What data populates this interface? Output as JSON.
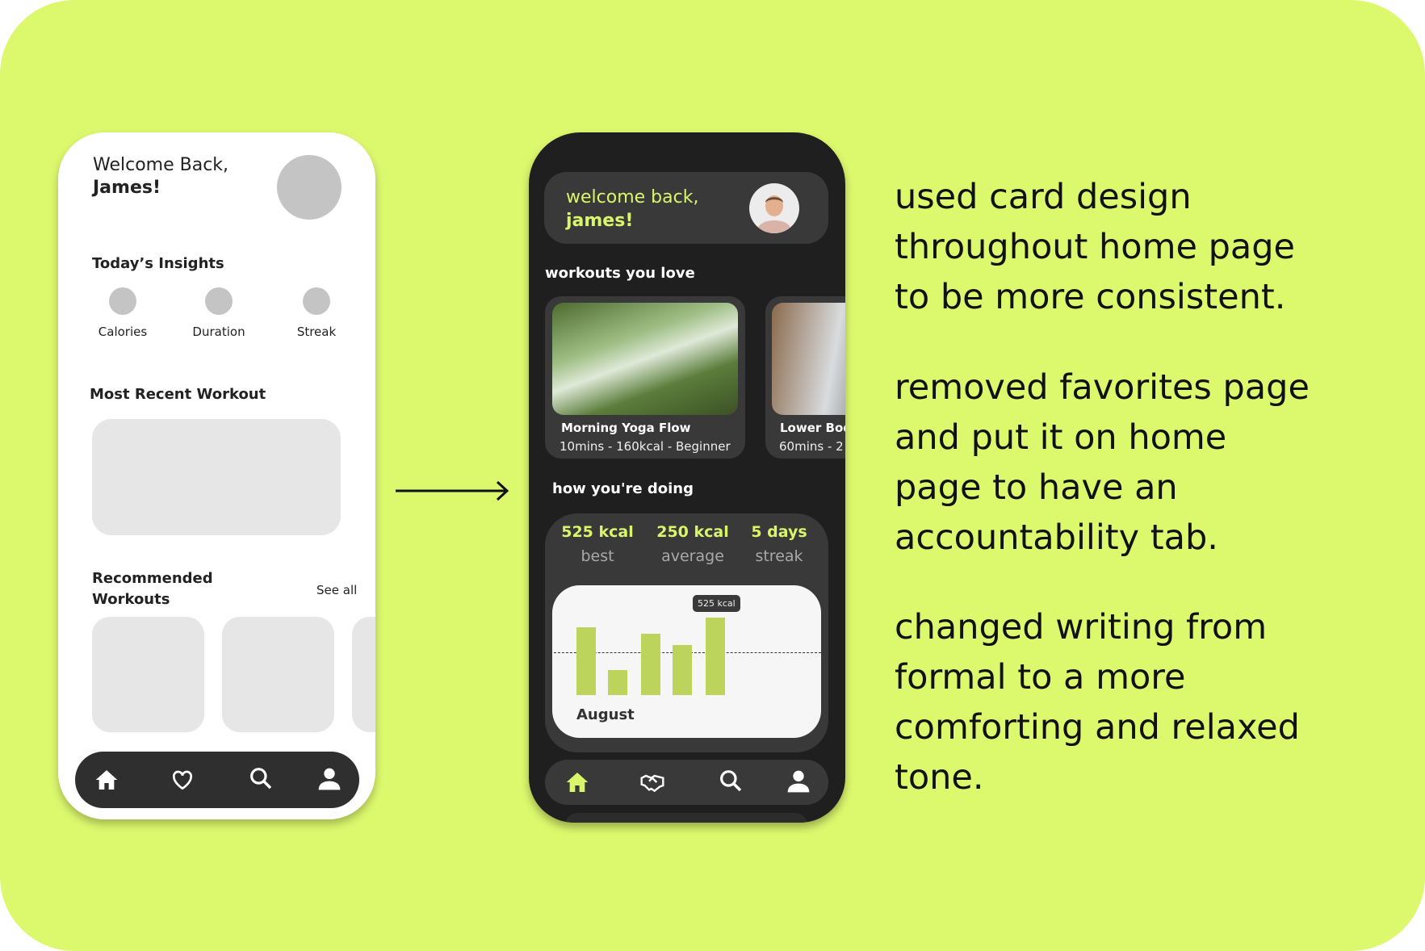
{
  "before": {
    "greeting": "Welcome Back,",
    "name": "James!",
    "insights_title": "Today’s Insights",
    "insights": [
      {
        "label": "Calories"
      },
      {
        "label": "Duration"
      },
      {
        "label": "Streak"
      }
    ],
    "recent_title": "Most Recent Workout",
    "recommended_title_1": "Recommended",
    "recommended_title_2": "Workouts",
    "see_all": "See all",
    "nav": [
      "home-icon",
      "heart-icon",
      "search-icon",
      "user-icon"
    ]
  },
  "after": {
    "greeting": "welcome back,",
    "name": "james!",
    "workouts_title": "workouts you love",
    "workouts": [
      {
        "title": "Morning Yoga Flow",
        "meta": "10mins - 160kcal - Beginner"
      },
      {
        "title": "Lower Bod",
        "meta": "60mins - 2"
      }
    ],
    "progress_title": "how you're doing",
    "stats": [
      {
        "value": "525 kcal",
        "label": "best"
      },
      {
        "value": "250 kcal",
        "label": "average"
      },
      {
        "value": "5 days",
        "label": "streak"
      }
    ],
    "nav": [
      "home-icon",
      "handshake-icon",
      "search-icon",
      "user-icon"
    ],
    "accent": "#d9f56b"
  },
  "chart_data": {
    "type": "bar",
    "values": [
      460,
      170,
      415,
      340,
      525
    ],
    "reference_line": 290,
    "tooltip": "525 kcal",
    "xlabel": "August",
    "bar_color": "#bcd35c"
  },
  "notes": [
    [
      "used card design",
      "throughout home page",
      "to be more consistent."
    ],
    [
      "removed favorites page",
      "and put it on home",
      "page to have an",
      "accountability tab."
    ],
    [
      "changed writing from",
      "formal to a more",
      "comforting and relaxed",
      "tone."
    ]
  ]
}
